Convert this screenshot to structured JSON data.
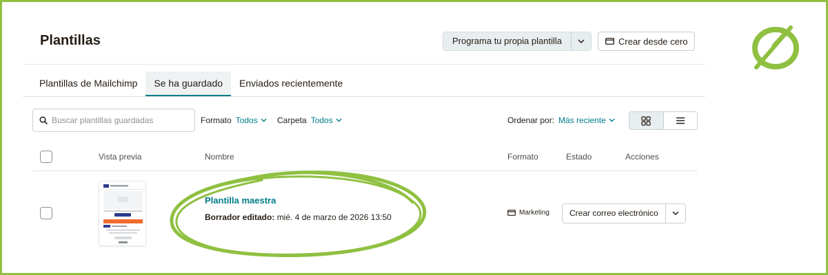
{
  "header": {
    "title": "Plantillas",
    "program_button_label": "Programa tu propia plantilla",
    "create_button_label": "Crear desde cero"
  },
  "tabs": [
    {
      "label": "Plantillas de Mailchimp",
      "active": false
    },
    {
      "label": "Se ha guardado",
      "active": true
    },
    {
      "label": "Enviados recientemente",
      "active": false
    }
  ],
  "toolbar": {
    "search_placeholder": "Buscar plantillas guardadas",
    "format_label": "Formato",
    "format_value": "Todos",
    "folder_label": "Carpeta",
    "folder_value": "Todos",
    "sort_label": "Ordenar por:",
    "sort_value": "Más reciente",
    "active_view": "list"
  },
  "table": {
    "columns": {
      "preview": "Vista previa",
      "name": "Nombre",
      "format": "Formato",
      "status": "Estado",
      "actions": "Acciones"
    },
    "rows": [
      {
        "name": "Plantilla maestra",
        "edited_label": "Borrador editado:",
        "edited_value": "mié. 4 de marzo de 2026 13:50",
        "format": "Marketing",
        "action_label": "Crear correo electrónico"
      }
    ]
  },
  "colors": {
    "accent": "#007c89",
    "highlight": "#8fc041",
    "thumbnail_banner": "#f06b2d"
  }
}
